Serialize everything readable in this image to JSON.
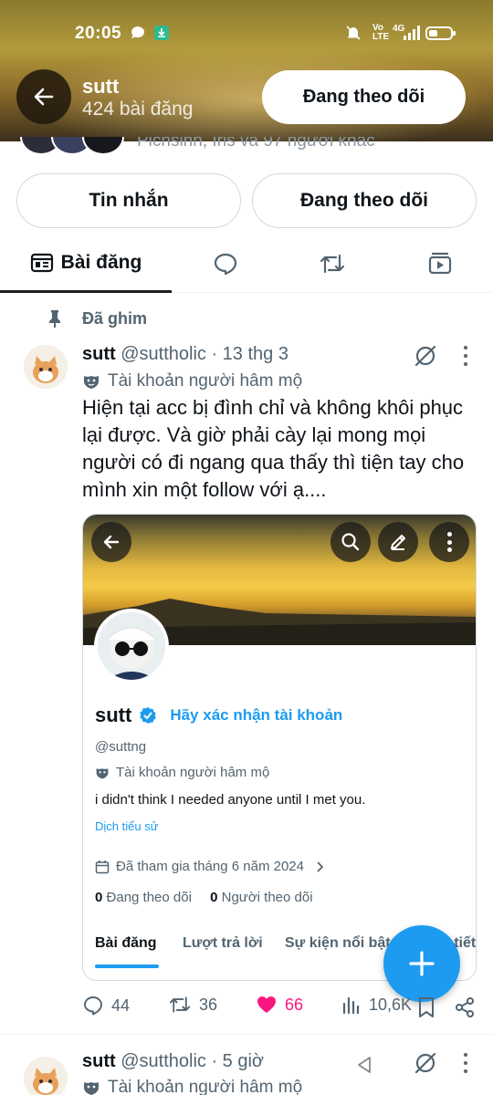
{
  "status_bar": {
    "time": "20:05",
    "net_label": "4G"
  },
  "header": {
    "name": "sutt",
    "posts_count": "424 bài đăng",
    "follow_button": "Đang theo dõi"
  },
  "behind": {
    "followers_text": "Pichsinh, Iris và 97 người khác"
  },
  "profile_actions": {
    "message_button": "Tin nhắn",
    "following_button": "Đang theo dõi"
  },
  "tabs": {
    "posts_label": "Bài đăng"
  },
  "pinned_label": "Đã ghim",
  "tweet1": {
    "name": "sutt",
    "handle_time": "@suttholic · 13 thg 3",
    "badge": "Tài khoản người hâm mộ",
    "text": "Hiện tại acc bị đình chỉ và không khôi phục lại được. Và giờ phải cày lại mong mọi người có đi ngang qua thấy thì tiện tay cho mình xin một follow với ạ....",
    "card": {
      "name": "sutt",
      "verify_prompt": "Hãy xác nhận tài khoản",
      "handle": "@suttng",
      "fan_label": "Tài khoản người hâm mộ",
      "bio": "i didn't think I needed anyone until I met you.",
      "translate": "Dịch tiểu sử",
      "joined": "Đã tham gia tháng 6 năm 2024",
      "following_count": "0",
      "following_label": "Đang theo dõi",
      "followers_count": "0",
      "followers_label": "Người theo dõi",
      "tab_posts": "Bài đăng",
      "tab_replies": "Lượt trả lời",
      "tab_highlights": "Sự kiện nổi bật",
      "tab_more": "Chi tiết"
    },
    "replies": "44",
    "reposts": "36",
    "likes": "66",
    "views": "10,6K"
  },
  "tweet2": {
    "name": "sutt",
    "handle_time": "@suttholic · 5 giờ",
    "badge": "Tài khoản người hâm mộ"
  },
  "colors": {
    "accent": "#1d9bf0",
    "like": "#f91880",
    "text": "#0f1419",
    "muted": "#536471"
  }
}
